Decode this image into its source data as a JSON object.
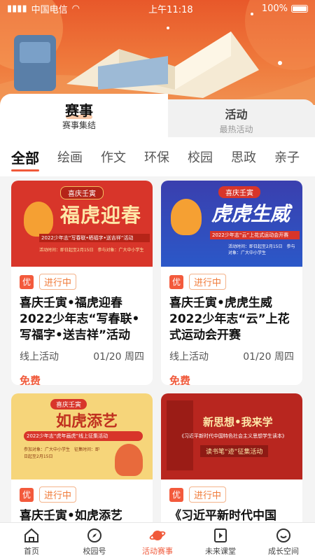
{
  "statusbar": {
    "carrier": "中国电信",
    "time": "上午11:18",
    "battery": "100%"
  },
  "tabs": [
    {
      "title": "赛事",
      "subtitle": "赛事集结"
    },
    {
      "title": "活动",
      "subtitle": "最热活动"
    }
  ],
  "filters": [
    "全部",
    "绘画",
    "作文",
    "环保",
    "校园",
    "思政",
    "亲子"
  ],
  "cards": [
    {
      "badge": "优",
      "status": "进行中",
      "title": "喜庆壬寅•福虎迎春2022少年志“写春联•写福字•送吉祥”活动",
      "mode": "线上活动",
      "date": "01/20 周四",
      "price": "免费",
      "img": {
        "banner": "喜庆壬寅",
        "headline": "福虎迎春",
        "sub": "2022少年志“写春联•晒福字•送吉祥”活动",
        "info": "活动时间：即日起至2月15日　参与对象：广大中小学生"
      }
    },
    {
      "badge": "优",
      "status": "进行中",
      "title": "喜庆壬寅•虎虎生威2022少年志“云”上花式运动会开赛",
      "mode": "线上活动",
      "date": "01/20 周四",
      "price": "免费",
      "img": {
        "banner": "喜庆壬寅",
        "headline": "虎虎生威",
        "sub": "2022少年志“云”上花式运动会开赛",
        "info": "活动时间：即日起至2月15日　参与对象：广大中小学生"
      }
    },
    {
      "badge": "优",
      "status": "进行中",
      "title": "喜庆壬寅•如虎添艺",
      "img": {
        "banner": "喜庆壬寅",
        "headline": "如虎添艺",
        "sub": "2022少年志“虎年画虎”线上征集活动",
        "info": "参加对象：广大中小学生　征集时间：即日起至2月15日"
      }
    },
    {
      "badge": "优",
      "status": "进行中",
      "title": "《习近平新时代中国",
      "img": {
        "banner": "新思想•我来学",
        "sub": "《习近平新时代中国特色社会主义思想学生读本》",
        "info": "读书笔“迹”征集活动"
      }
    }
  ],
  "nav": [
    {
      "label": "首页",
      "icon": "home-icon"
    },
    {
      "label": "校园号",
      "icon": "compass-icon"
    },
    {
      "label": "活动赛事",
      "icon": "planet-icon",
      "active": true
    },
    {
      "label": "未来课堂",
      "icon": "play-icon"
    },
    {
      "label": "成长空间",
      "icon": "smile-icon"
    }
  ],
  "colors": {
    "accent": "#f0593a",
    "hero": "#e8582a",
    "status_tag": "#f07b3a"
  }
}
